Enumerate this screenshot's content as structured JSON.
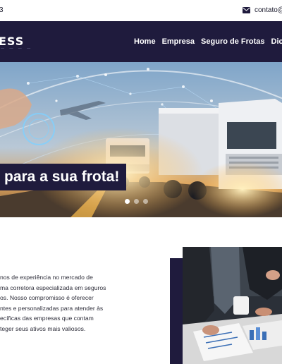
{
  "topbar": {
    "phone": "3",
    "email": "contato@"
  },
  "brand": {
    "logo": "ESS",
    "tagline": "—   —"
  },
  "nav": {
    "items": [
      "Home",
      "Empresa",
      "Seguro de Frotas",
      "Dicas"
    ]
  },
  "hero": {
    "caption": "para a sua frota!",
    "slide_count": 3,
    "active_slide": 1
  },
  "about": {
    "lines": [
      "nos de experiência no mercado de",
      "ma corretora especializada em seguros",
      "os. Nosso compromisso é oferecer",
      "ntes e personalizadas para atender às",
      "ecíficas das empresas que contam",
      "teger seus ativos mais valiosos."
    ]
  },
  "colors": {
    "navy": "#1f1b3d",
    "accent_blue": "#2f7fd6"
  },
  "icons": {
    "email": "envelope-icon"
  }
}
